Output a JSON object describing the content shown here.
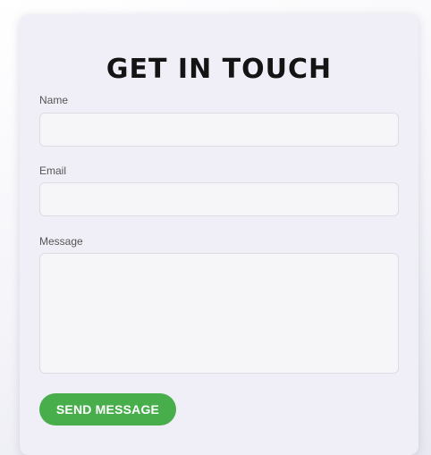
{
  "form": {
    "title": "GET IN TOUCH",
    "name_label": "Name",
    "name_value": "",
    "email_label": "Email",
    "email_value": "",
    "message_label": "Message",
    "message_value": "",
    "submit_label": "SEND MESSAGE"
  },
  "colors": {
    "card_background": "#f0eff7",
    "field_background": "#f6f6f9",
    "button": "#48ae4c",
    "title": "#141414"
  }
}
